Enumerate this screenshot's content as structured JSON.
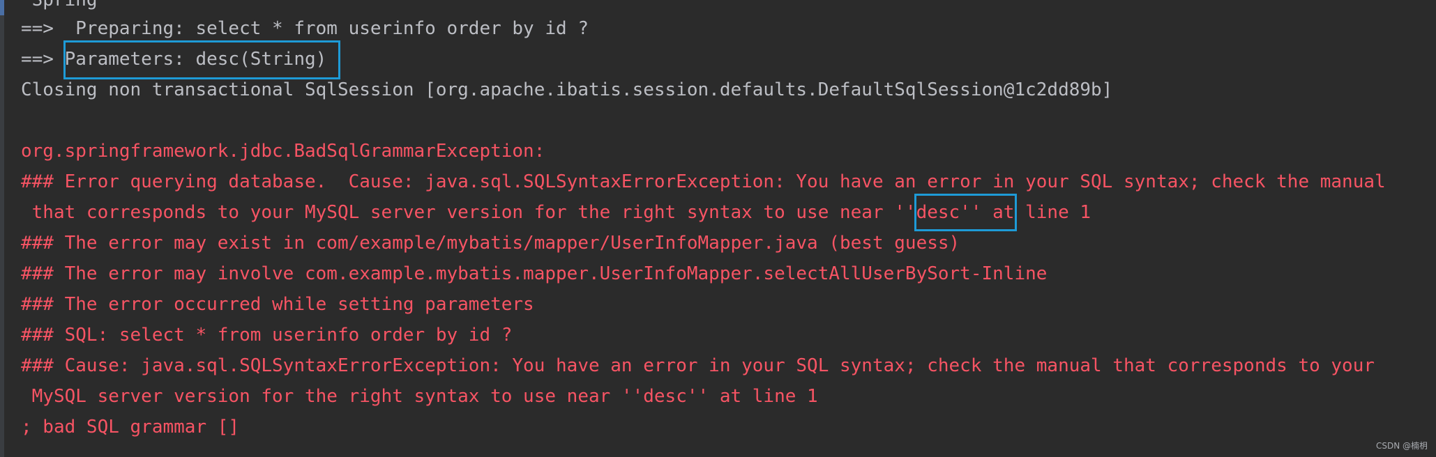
{
  "console": {
    "lines": [
      {
        "text": " Spring",
        "kind": "log"
      },
      {
        "text": "==>  Preparing: select * from userinfo order by id ?",
        "kind": "log"
      },
      {
        "text": "==> Parameters: desc(String)",
        "kind": "log"
      },
      {
        "text": "Closing non transactional SqlSession [org.apache.ibatis.session.defaults.DefaultSqlSession@1c2dd89b]",
        "kind": "log"
      },
      {
        "text": "",
        "kind": "blank"
      },
      {
        "text": "org.springframework.jdbc.BadSqlGrammarException:",
        "kind": "error"
      },
      {
        "text": "### Error querying database.  Cause: java.sql.SQLSyntaxErrorException: You have an error in your SQL syntax; check the manual",
        "kind": "error"
      },
      {
        "text": " that corresponds to your MySQL server version for the right syntax to use near ''desc'' at line 1",
        "kind": "error"
      },
      {
        "text": "### The error may exist in com/example/mybatis/mapper/UserInfoMapper.java (best guess)",
        "kind": "error"
      },
      {
        "text": "### The error may involve com.example.mybatis.mapper.UserInfoMapper.selectAllUserBySort-Inline",
        "kind": "error"
      },
      {
        "text": "### The error occurred while setting parameters",
        "kind": "error"
      },
      {
        "text": "### SQL: select * from userinfo order by id ?",
        "kind": "error"
      },
      {
        "text": "### Cause: java.sql.SQLSyntaxErrorException: You have an error in your SQL syntax; check the manual that corresponds to your",
        "kind": "error"
      },
      {
        "text": " MySQL server version for the right syntax to use near ''desc'' at line 1",
        "kind": "error"
      },
      {
        "text": "; bad SQL grammar []",
        "kind": "error"
      }
    ]
  },
  "watermark": "CSDN @楠枂",
  "colors": {
    "background": "#2b2b2b",
    "log_text": "#bcbec4",
    "error_text": "#f75464",
    "highlight_box": "#1e9bd7"
  }
}
